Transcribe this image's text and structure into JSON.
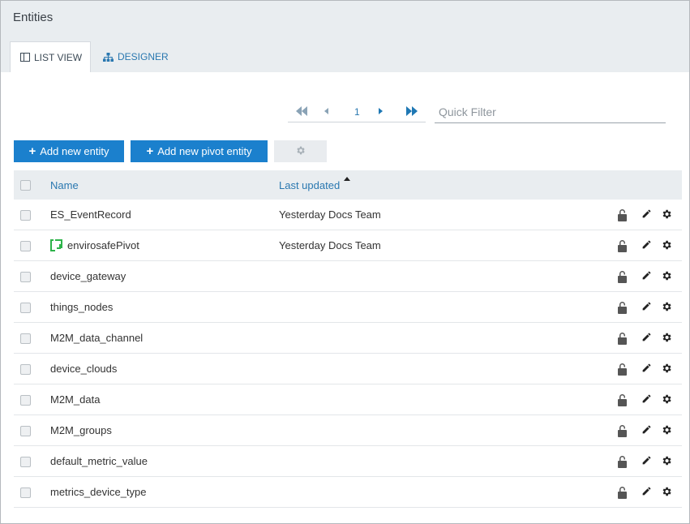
{
  "title": "Entities",
  "tabs": [
    {
      "label": "LIST VIEW",
      "icon": "list-view-icon",
      "active": true
    },
    {
      "label": "DESIGNER",
      "icon": "hierarchy-icon",
      "active": false
    }
  ],
  "pager": {
    "page": "1"
  },
  "filter": {
    "placeholder": "Quick Filter",
    "value": ""
  },
  "toolbar": {
    "add_entity": "Add new entity",
    "add_pivot": "Add new pivot entity",
    "settings_icon": "gear-icon"
  },
  "table": {
    "columns": {
      "name": "Name",
      "updated": "Last updated"
    },
    "sort": {
      "column": "Last updated",
      "direction": "ascending"
    },
    "rows": [
      {
        "name": "ES_EventRecord",
        "updated": "Yesterday Docs Team",
        "pivot": false
      },
      {
        "name": "envirosafePivot",
        "updated": "Yesterday Docs Team",
        "pivot": true
      },
      {
        "name": "device_gateway",
        "updated": "",
        "pivot": false
      },
      {
        "name": "things_nodes",
        "updated": "",
        "pivot": false
      },
      {
        "name": "M2M_data_channel",
        "updated": "",
        "pivot": false
      },
      {
        "name": "device_clouds",
        "updated": "",
        "pivot": false
      },
      {
        "name": "M2M_data",
        "updated": "",
        "pivot": false
      },
      {
        "name": "M2M_groups",
        "updated": "",
        "pivot": false
      },
      {
        "name": "default_metric_value",
        "updated": "",
        "pivot": false
      },
      {
        "name": "metrics_device_type",
        "updated": "",
        "pivot": false
      }
    ]
  },
  "colors": {
    "accent": "#1b80cd",
    "link": "#2a78b0",
    "pivot_icon": "#2db34a",
    "header_bg": "#e9edf0"
  }
}
